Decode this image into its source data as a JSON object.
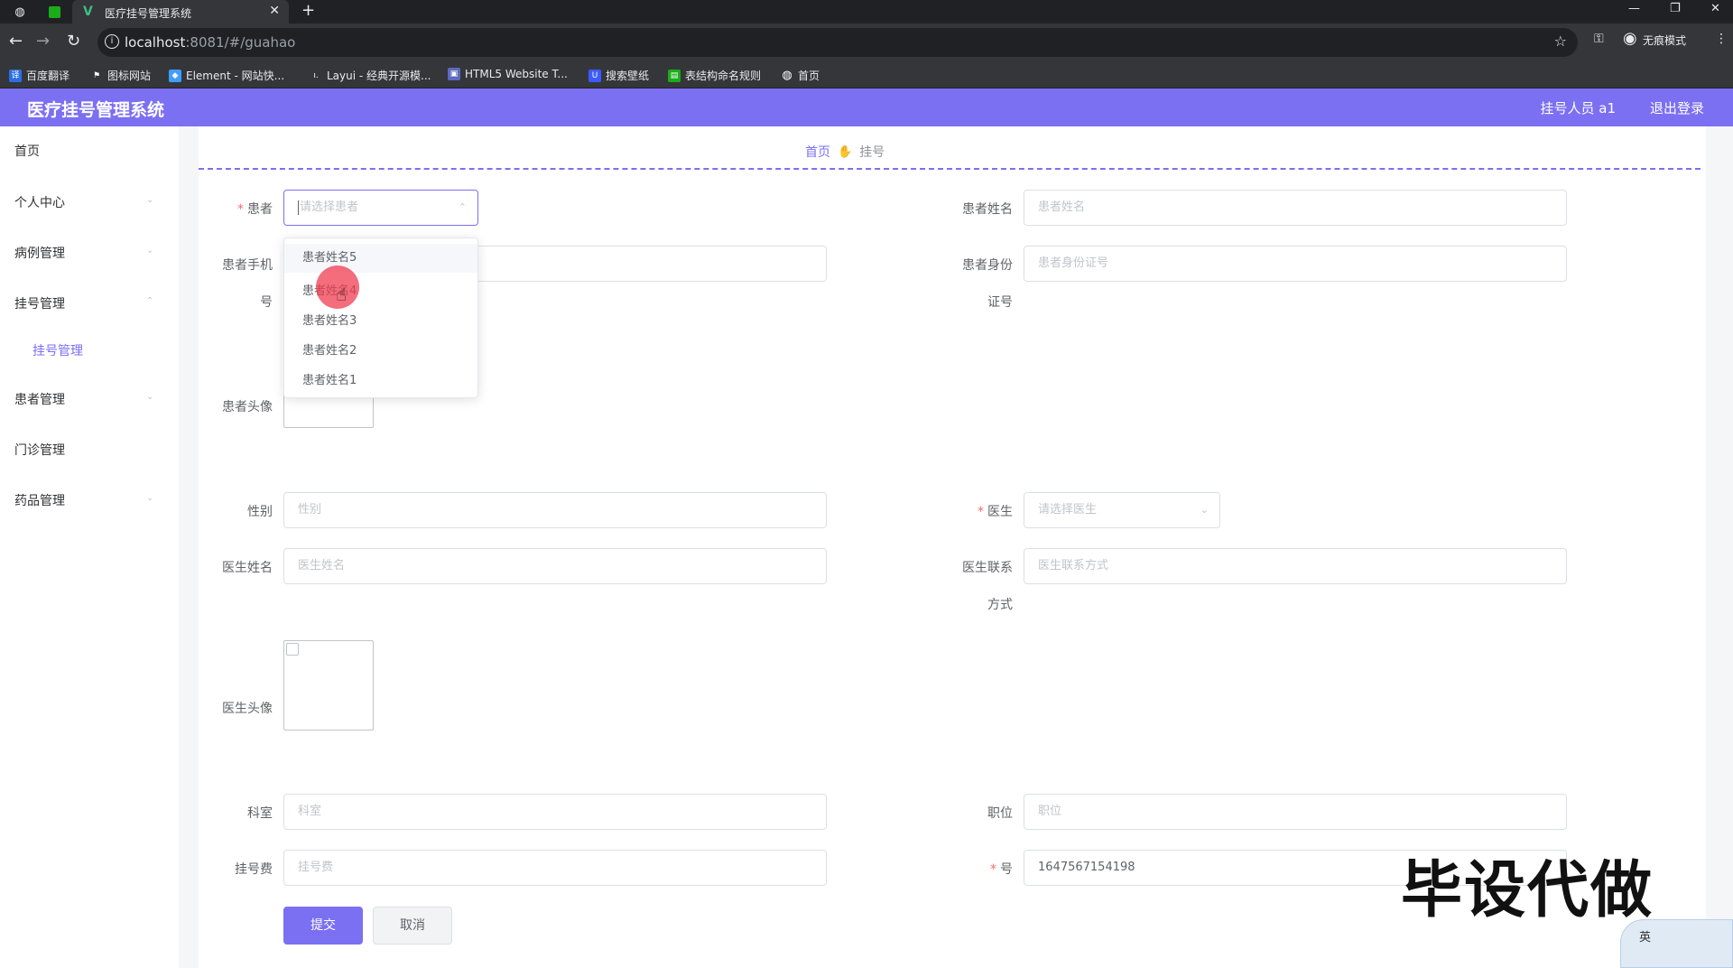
{
  "browser": {
    "tab_title": "医疗挂号管理系统",
    "url_host": "localhost",
    "url_rest": ":8081/#/guahao",
    "incognito_label": "无痕模式",
    "bookmarks": [
      "百度翻译",
      "图标网站",
      "Element - 网站快...",
      "Layui - 经典开源模...",
      "HTML5 Website T...",
      "搜索壁纸",
      "表结构命名规则",
      "首页"
    ]
  },
  "app": {
    "title": "医疗挂号管理系统",
    "user": "挂号人员 a1",
    "logout": "退出登录"
  },
  "sidebar": {
    "items": [
      "首页",
      "个人中心",
      "病例管理",
      "挂号管理",
      "患者管理",
      "门诊管理",
      "药品管理"
    ],
    "sub_item": "挂号管理"
  },
  "breadcrumb": {
    "home": "首页",
    "current": "挂号"
  },
  "form": {
    "patient_label": "患者",
    "patient_placeholder": "请选择患者",
    "patient_name_label": "患者姓名",
    "patient_name_placeholder": "患者姓名",
    "patient_phone_label_1": "患者手机",
    "patient_phone_label_2": "号",
    "patient_id_label_1": "患者身份",
    "patient_id_label_2": "证号",
    "patient_id_placeholder": "患者身份证号",
    "patient_avatar_label": "患者头像",
    "gender_label": "性别",
    "gender_placeholder": "性别",
    "doctor_label": "医生",
    "doctor_placeholder": "请选择医生",
    "doctor_name_label": "医生姓名",
    "doctor_name_placeholder": "医生姓名",
    "doctor_contact_label_1": "医生联系",
    "doctor_contact_label_2": "方式",
    "doctor_contact_placeholder": "医生联系方式",
    "doctor_avatar_label": "医生头像",
    "dept_label": "科室",
    "dept_placeholder": "科室",
    "position_label": "职位",
    "position_placeholder": "职位",
    "fee_label": "挂号费",
    "fee_placeholder": "挂号费",
    "number_label": "号",
    "number_value": "1647567154198",
    "submit": "提交",
    "cancel": "取消"
  },
  "dropdown": {
    "options": [
      "患者姓名5",
      "患者姓名4",
      "患者姓名3",
      "患者姓名2",
      "患者姓名1"
    ]
  },
  "overlay": {
    "watermark": "毕设代做",
    "ime_key": "英"
  },
  "colors": {
    "accent": "#7b6ff2",
    "required": "#f56c6c"
  }
}
